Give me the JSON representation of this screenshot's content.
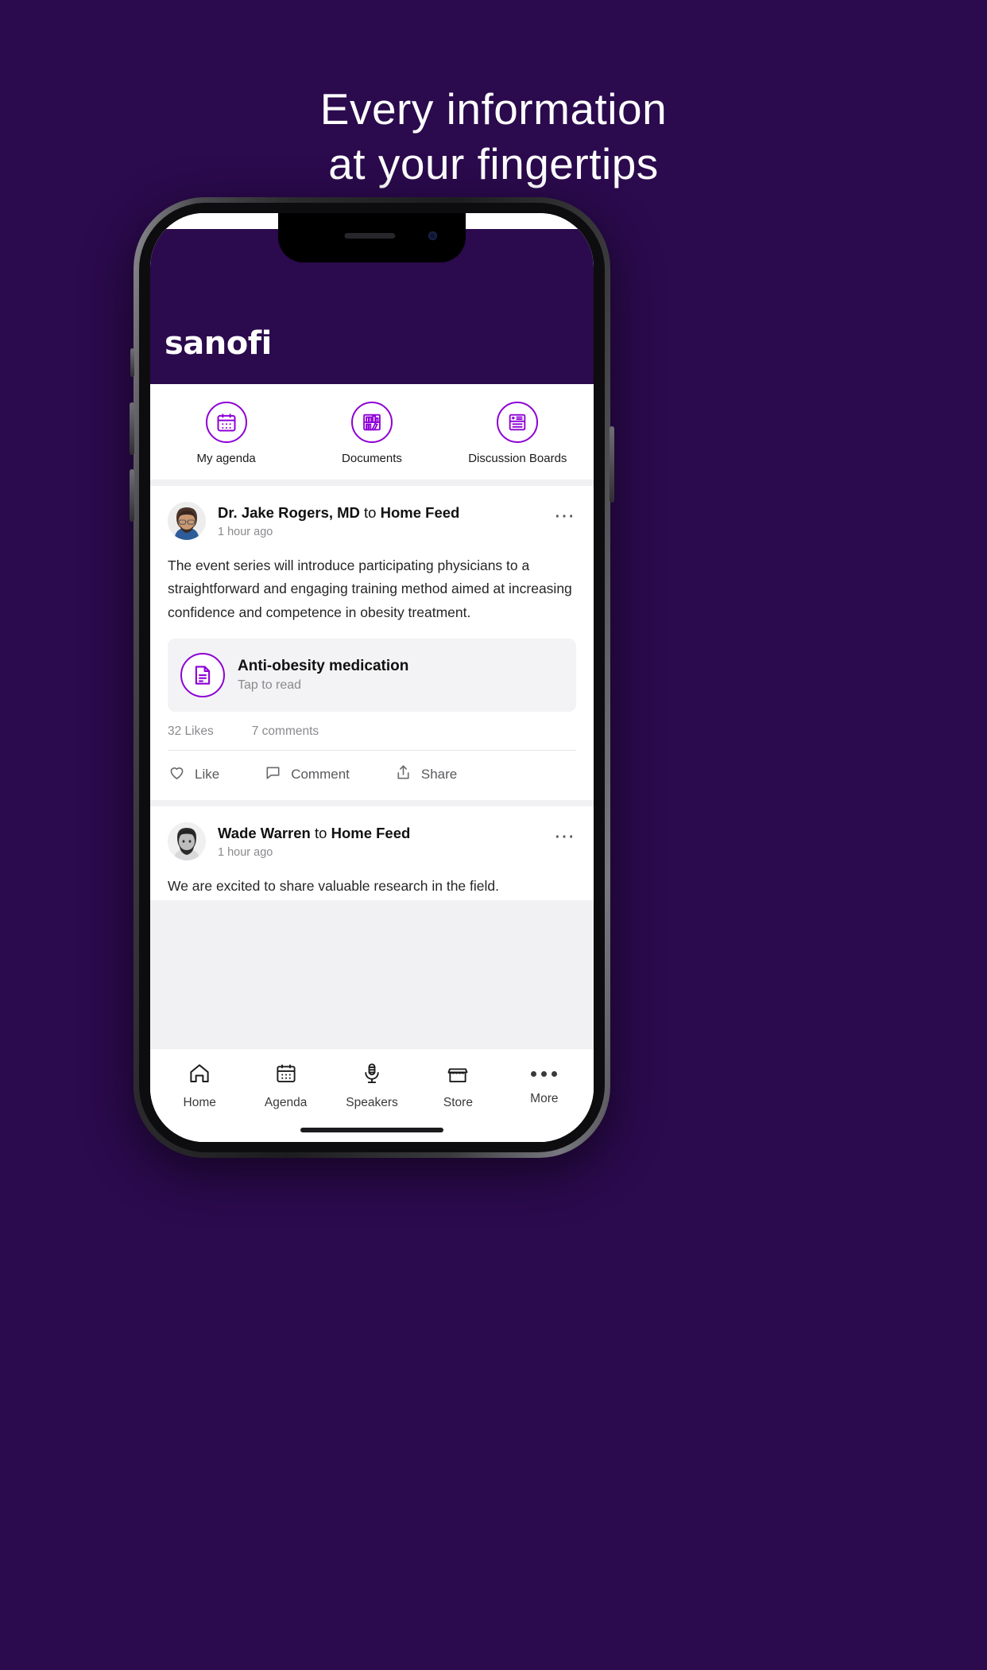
{
  "page": {
    "background_color": "#2B0A4D",
    "headline_line1": "Every information",
    "headline_line2": "at your fingertips",
    "accent_color": "#8E00D6",
    "brand_color": "#2B0A4D"
  },
  "app": {
    "logo": "sanofi",
    "quick_actions": [
      {
        "label": "My agenda",
        "icon": "calendar-icon"
      },
      {
        "label": "Documents",
        "icon": "bookshelf-icon"
      },
      {
        "label": "Discussion Boards",
        "icon": "discussion-board-icon"
      }
    ],
    "posts": [
      {
        "author": "Dr. Jake Rogers, MD",
        "preposition": "to",
        "target": "Home Feed",
        "time": "1 hour ago",
        "body": "The event series will introduce participating physicians to a straightforward and engaging training method aimed at increasing confidence and competence in obesity treatment.",
        "attachment": {
          "title": "Anti-obesity medication",
          "subtitle": "Tap to read",
          "icon": "document-icon"
        },
        "likes": "32 Likes",
        "comments": "7 comments",
        "actions": [
          {
            "label": "Like",
            "icon": "heart-icon"
          },
          {
            "label": "Comment",
            "icon": "speech-bubble-icon"
          },
          {
            "label": "Share",
            "icon": "share-icon"
          }
        ],
        "more_icon": "ellipsis-icon"
      },
      {
        "author": "Wade Warren",
        "preposition": "to",
        "target": "Home Feed",
        "time": "1 hour ago",
        "body": "We are excited to share valuable research in the field.",
        "more_icon": "ellipsis-icon"
      }
    ],
    "bottom_nav": [
      {
        "label": "Home",
        "icon": "home-icon"
      },
      {
        "label": "Agenda",
        "icon": "calendar-icon"
      },
      {
        "label": "Speakers",
        "icon": "microphone-icon"
      },
      {
        "label": "Store",
        "icon": "storefront-icon"
      },
      {
        "label": "More",
        "icon": "ellipsis-icon"
      }
    ]
  }
}
